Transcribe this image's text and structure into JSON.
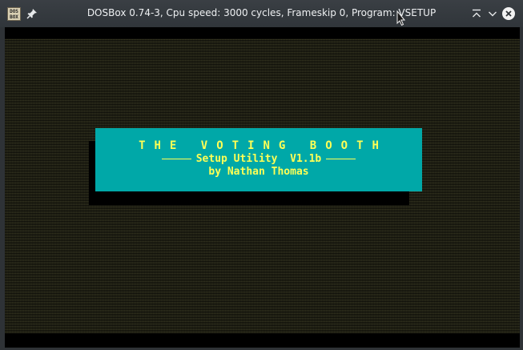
{
  "window": {
    "title": "DOSBox 0.74-3, Cpu speed: 3000 cycles, Frameskip 0, Program: VSETUP",
    "app_icon_text": [
      "DOS",
      "BOX"
    ]
  },
  "banner": {
    "title": "THE VOTING BOOTH",
    "subtitle": "Setup Utility  V1.1b",
    "author": "by Nathan Thomas"
  },
  "colors": {
    "banner_bg": "#00a8a8",
    "banner_text": "#ffff55",
    "screen_bg": "#000000"
  },
  "icons": [
    "dosbox-app-icon",
    "pin-icon",
    "keep-above-icon",
    "minimize-icon",
    "close-icon",
    "mouse-cursor-icon"
  ]
}
